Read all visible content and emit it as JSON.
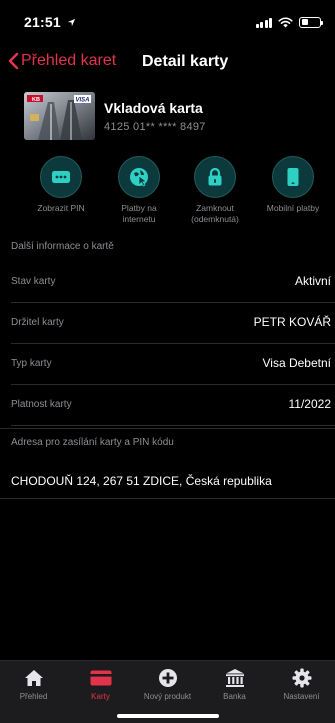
{
  "status_bar": {
    "time": "21:51",
    "location_icon": "location-arrow-icon",
    "battery_level": 0.4
  },
  "nav": {
    "back_label": "Přehled karet",
    "title": "Detail karty"
  },
  "card": {
    "name": "Vkladová karta",
    "number": "4125 01** **** 8497",
    "thumb_logo_left": "KB",
    "thumb_logo_right": "VISA"
  },
  "actions": [
    {
      "label": "Zobrazit PIN",
      "icon": "pin-dots-icon"
    },
    {
      "label": "Platby na internetu",
      "icon": "globe-cursor-icon"
    },
    {
      "label": "Zamknout (odemknutá)",
      "icon": "lock-icon"
    },
    {
      "label": "Mobilní platby",
      "icon": "phone-icon"
    }
  ],
  "info": {
    "section_title": "Další informace o kartě",
    "rows": [
      {
        "label": "Stav karty",
        "value": "Aktivní"
      },
      {
        "label": "Držitel karty",
        "value": "PETR KOVÁŘ"
      },
      {
        "label": "Typ karty",
        "value": "Visa Debetní"
      },
      {
        "label": "Platnost karty",
        "value": "11/2022"
      }
    ],
    "address_label": "Adresa pro zasílání karty a PIN kódu",
    "address_value": "CHODOUŇ 124, 267 51 ZDICE, Česká republika"
  },
  "tabbar": {
    "items": [
      {
        "label": "Přehled",
        "icon": "home-icon",
        "active": false
      },
      {
        "label": "Karty",
        "icon": "card-icon",
        "active": true
      },
      {
        "label": "Nový produkt",
        "icon": "plus-circle-icon",
        "active": false
      },
      {
        "label": "Banka",
        "icon": "bank-icon",
        "active": false
      },
      {
        "label": "Nastavení",
        "icon": "gear-icon",
        "active": false
      }
    ]
  },
  "colors": {
    "accent": "#e2334b",
    "action_bg": "#0c3a3c",
    "action_icon": "#2fd0c4",
    "background": "#000000",
    "muted": "#8e8e93"
  }
}
